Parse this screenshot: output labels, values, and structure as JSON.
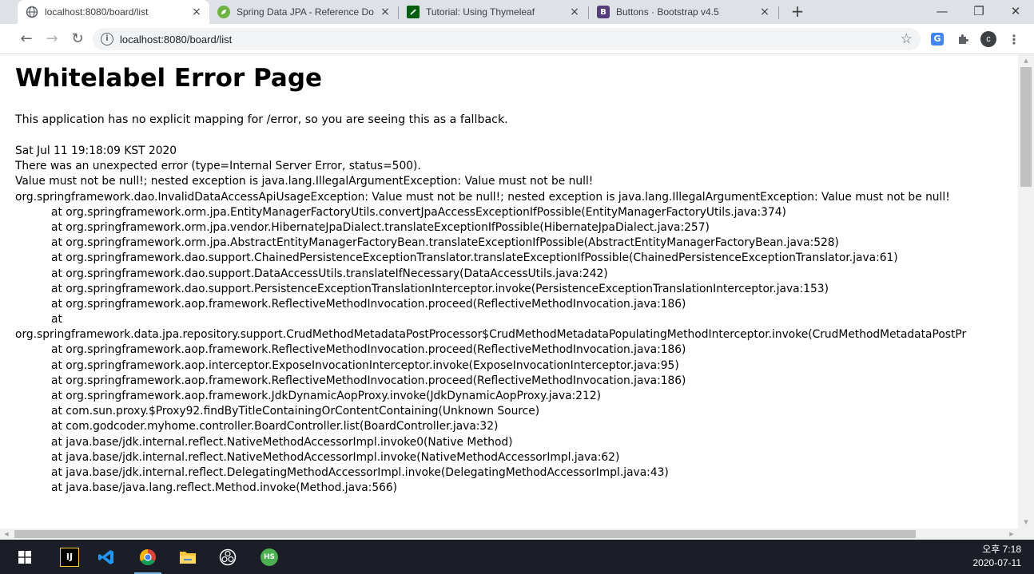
{
  "browser": {
    "tabs": [
      {
        "title": "localhost:8080/board/list",
        "favicon": "globe-icon",
        "active": true
      },
      {
        "title": "Spring Data JPA - Reference Do",
        "favicon": "spring-icon",
        "active": false
      },
      {
        "title": "Tutorial: Using Thymeleaf",
        "favicon": "thymeleaf-icon",
        "active": false
      },
      {
        "title": "Buttons · Bootstrap v4.5",
        "favicon": "bootstrap-icon",
        "active": false
      }
    ],
    "close_glyph": "×",
    "new_tab_glyph": "+",
    "window_controls": {
      "minimize": "—",
      "restore": "❐",
      "close": "✕"
    },
    "nav": {
      "back": "←",
      "forward": "→",
      "reload": "↻"
    },
    "address": {
      "url": "localhost:8080/board/list"
    },
    "profile_initial": "c",
    "colors": {
      "spring": "#6db33f",
      "thymeleaf": "#005f0f",
      "bootstrap": "#563d7c"
    }
  },
  "page": {
    "title": "Whitelabel Error Page",
    "description": "This application has no explicit mapping for /error, so you are seeing this as a fallback.",
    "timestamp": "Sat Jul 11 19:18:09 KST 2020",
    "error_lines": [
      {
        "text": "There was an unexpected error (type=Internal Server Error, status=500).",
        "indent": false
      },
      {
        "text": "Value must not be null!; nested exception is java.lang.IllegalArgumentException: Value must not be null!",
        "indent": false
      },
      {
        "text": "org.springframework.dao.InvalidDataAccessApiUsageException: Value must not be null!; nested exception is java.lang.IllegalArgumentException: Value must not be null!",
        "indent": false
      },
      {
        "text": "at org.springframework.orm.jpa.EntityManagerFactoryUtils.convertJpaAccessExceptionIfPossible(EntityManagerFactoryUtils.java:374)",
        "indent": true
      },
      {
        "text": "at org.springframework.orm.jpa.vendor.HibernateJpaDialect.translateExceptionIfPossible(HibernateJpaDialect.java:257)",
        "indent": true
      },
      {
        "text": "at org.springframework.orm.jpa.AbstractEntityManagerFactoryBean.translateExceptionIfPossible(AbstractEntityManagerFactoryBean.java:528)",
        "indent": true
      },
      {
        "text": "at org.springframework.dao.support.ChainedPersistenceExceptionTranslator.translateExceptionIfPossible(ChainedPersistenceExceptionTranslator.java:61)",
        "indent": true
      },
      {
        "text": "at org.springframework.dao.support.DataAccessUtils.translateIfNecessary(DataAccessUtils.java:242)",
        "indent": true
      },
      {
        "text": "at org.springframework.dao.support.PersistenceExceptionTranslationInterceptor.invoke(PersistenceExceptionTranslationInterceptor.java:153)",
        "indent": true
      },
      {
        "text": "at org.springframework.aop.framework.ReflectiveMethodInvocation.proceed(ReflectiveMethodInvocation.java:186)",
        "indent": true
      },
      {
        "text": "at",
        "indent": true
      },
      {
        "text": "org.springframework.data.jpa.repository.support.CrudMethodMetadataPostProcessor$CrudMethodMetadataPopulatingMethodInterceptor.invoke(CrudMethodMetadataPostPr",
        "indent": false
      },
      {
        "text": "at org.springframework.aop.framework.ReflectiveMethodInvocation.proceed(ReflectiveMethodInvocation.java:186)",
        "indent": true
      },
      {
        "text": "at org.springframework.aop.interceptor.ExposeInvocationInterceptor.invoke(ExposeInvocationInterceptor.java:95)",
        "indent": true
      },
      {
        "text": "at org.springframework.aop.framework.ReflectiveMethodInvocation.proceed(ReflectiveMethodInvocation.java:186)",
        "indent": true
      },
      {
        "text": "at org.springframework.aop.framework.JdkDynamicAopProxy.invoke(JdkDynamicAopProxy.java:212)",
        "indent": true
      },
      {
        "text": "at com.sun.proxy.$Proxy92.findByTitleContainingOrContentContaining(Unknown Source)",
        "indent": true
      },
      {
        "text": "at com.godcoder.myhome.controller.BoardController.list(BoardController.java:32)",
        "indent": true
      },
      {
        "text": "at java.base/jdk.internal.reflect.NativeMethodAccessorImpl.invoke0(Native Method)",
        "indent": true
      },
      {
        "text": "at java.base/jdk.internal.reflect.NativeMethodAccessorImpl.invoke(NativeMethodAccessorImpl.java:62)",
        "indent": true
      },
      {
        "text": "at java.base/jdk.internal.reflect.DelegatingMethodAccessorImpl.invoke(DelegatingMethodAccessorImpl.java:43)",
        "indent": true
      },
      {
        "text": "at java.base/java.lang.reflect.Method.invoke(Method.java:566)",
        "indent": true
      }
    ]
  },
  "taskbar": {
    "apps": [
      {
        "name": "windows-start",
        "icon": "windows-icon"
      },
      {
        "name": "intellij",
        "icon": "intellij-icon",
        "glyph": "IJ"
      },
      {
        "name": "vscode",
        "icon": "vscode-icon"
      },
      {
        "name": "chrome",
        "icon": "chrome-icon",
        "active": true
      },
      {
        "name": "file-explorer",
        "icon": "folder-icon"
      },
      {
        "name": "obs",
        "icon": "obs-icon"
      },
      {
        "name": "heidisql",
        "icon": "heidisql-icon",
        "glyph": "HS"
      }
    ],
    "clock": {
      "time": "오후 7:18",
      "date": "2020-07-11"
    }
  }
}
